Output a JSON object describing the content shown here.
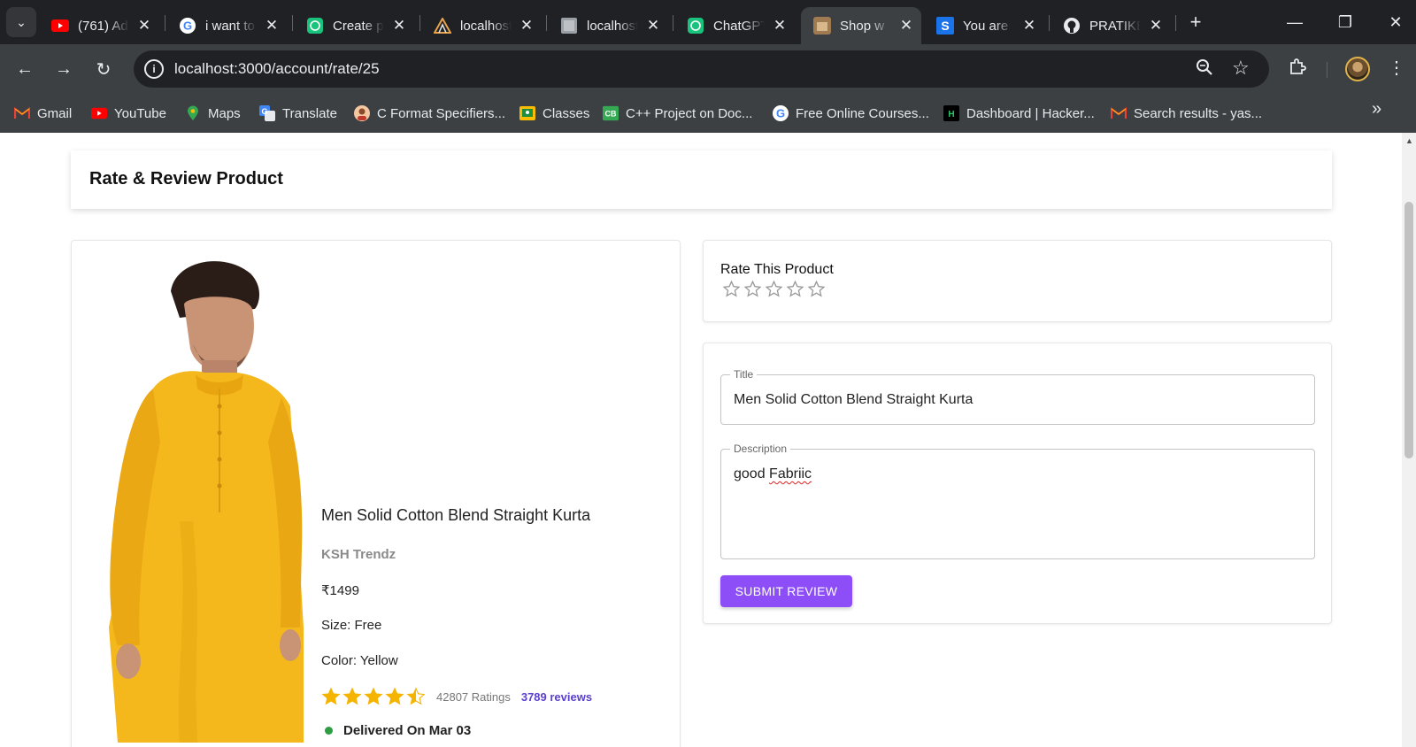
{
  "browser": {
    "tabs": [
      {
        "title": "(761) Ad",
        "icon": "youtube-icon"
      },
      {
        "title": "i want to",
        "icon": "google-icon"
      },
      {
        "title": "Create p",
        "icon": "chatgpt-icon"
      },
      {
        "title": "localhost",
        "icon": "site-icon"
      },
      {
        "title": "localhost",
        "icon": "image-icon"
      },
      {
        "title": "ChatGPT",
        "icon": "chatgpt-icon"
      },
      {
        "title": "Shop w",
        "icon": "shop-icon",
        "active": true
      },
      {
        "title": "You are",
        "icon": "s-icon"
      },
      {
        "title": "PRATIKE",
        "icon": "github-icon"
      }
    ],
    "url": "localhost:3000/account/rate/25",
    "bookmarks": [
      {
        "label": "Gmail",
        "icon": "gmail-icon"
      },
      {
        "label": "YouTube",
        "icon": "youtube-icon"
      },
      {
        "label": "Maps",
        "icon": "maps-icon"
      },
      {
        "label": "Translate",
        "icon": "translate-icon"
      },
      {
        "label": "C Format Specifiers...",
        "icon": "avatar-icon"
      },
      {
        "label": "Classes",
        "icon": "classroom-icon"
      },
      {
        "label": "C++ Project on Doc...",
        "icon": "cb-icon"
      },
      {
        "label": "Free Online Courses...",
        "icon": "google-icon"
      },
      {
        "label": "Dashboard | Hacker...",
        "icon": "hackerrank-icon"
      },
      {
        "label": "Search results - yas...",
        "icon": "gmail-icon"
      }
    ]
  },
  "page": {
    "heading": "Rate & Review Product",
    "product": {
      "name": "Men Solid Cotton Blend Straight Kurta",
      "brand": "KSH Trendz",
      "price": "₹1499",
      "size": "Size: Free",
      "color": "Color: Yellow",
      "rating": 4.5,
      "ratings_count": "42807 Ratings",
      "reviews_count": "3789 reviews",
      "delivery": "Delivered On Mar 03"
    },
    "rate": {
      "label": "Rate This Product",
      "value": 0,
      "max": 5
    },
    "form": {
      "title_label": "Title",
      "title_value": "Men Solid Cotton Blend Straight Kurta",
      "description_label": "Description",
      "description_prefix": "good ",
      "description_misspelled": "Fabriic",
      "submit_label": "SUBMIT REVIEW"
    }
  },
  "colors": {
    "accent": "#8d4ef7",
    "star_filled": "#f4b400",
    "link": "#5c3fcf",
    "delivered": "#2e9e45"
  }
}
